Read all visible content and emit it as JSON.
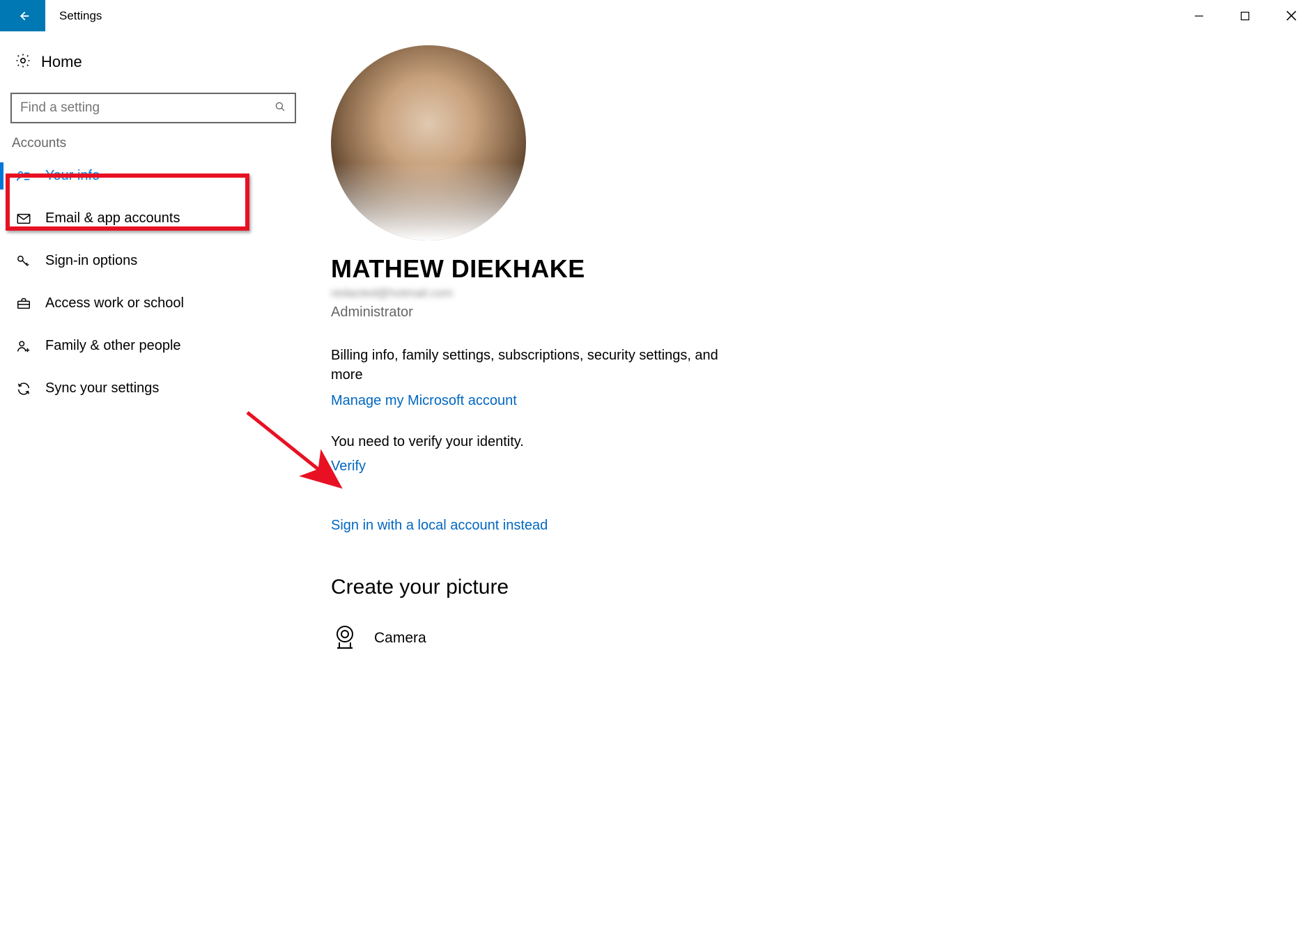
{
  "titlebar": {
    "title": "Settings"
  },
  "home": {
    "label": "Home"
  },
  "search": {
    "placeholder": "Find a setting"
  },
  "section": {
    "label": "Accounts"
  },
  "nav": [
    {
      "label": "Your info"
    },
    {
      "label": "Email & app accounts"
    },
    {
      "label": "Sign-in options"
    },
    {
      "label": "Access work or school"
    },
    {
      "label": "Family & other people"
    },
    {
      "label": "Sync your settings"
    }
  ],
  "profile": {
    "name": "MATHEW DIEKHAKE",
    "email": "redacted@hotmail.com",
    "role": "Administrator",
    "description": "Billing info, family settings, subscriptions, security settings, and more",
    "manage_link": "Manage my Microsoft account",
    "verify_text": "You need to verify your identity.",
    "verify_link": "Verify",
    "local_link": "Sign in with a local account instead"
  },
  "picture": {
    "heading": "Create your picture",
    "camera": "Camera"
  }
}
